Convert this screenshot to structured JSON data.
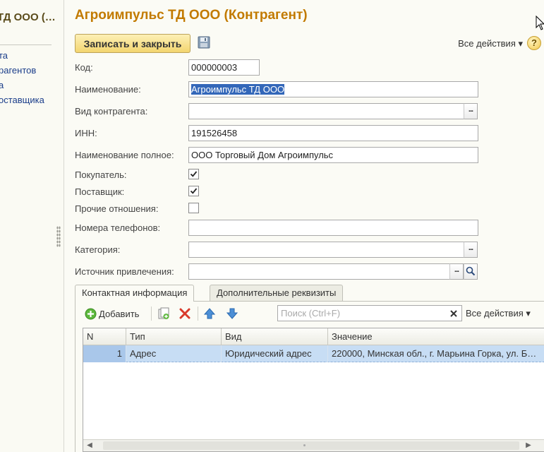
{
  "left_panel": {
    "title": "ТД ООО (…",
    "links": [
      "та",
      "рагентов",
      "а",
      "оставщика"
    ]
  },
  "form": {
    "title": "Агроимпульс ТД ООО (Контрагент)",
    "save_close_label": "Записать и закрыть",
    "all_actions_label": "Все действия ▾",
    "help_label": "?"
  },
  "fields": {
    "code_label": "Код:",
    "code_value": "000000003",
    "name_label": "Наименование:",
    "name_value": "Агроимпульс ТД ООО",
    "kind_label": "Вид контрагента:",
    "kind_value": "",
    "inn_label": "ИНН:",
    "inn_value": "191526458",
    "full_name_label": "Наименование полное:",
    "full_name_value": "ООО Торговый Дом Агроимпульс",
    "buyer_label": "Покупатель:",
    "buyer_checked": true,
    "supplier_label": "Поставщик:",
    "supplier_checked": true,
    "other_label": "Прочие отношения:",
    "other_checked": false,
    "phones_label": "Номера телефонов:",
    "phones_value": "",
    "category_label": "Категория:",
    "category_value": "",
    "source_label": "Источник привлечения:",
    "source_value": ""
  },
  "tabs": [
    {
      "label": "Контактная информация",
      "active": true
    },
    {
      "label": "Дополнительные реквизиты",
      "active": false
    }
  ],
  "contact_toolbar": {
    "add_label": "Добавить",
    "search_placeholder": "Поиск (Ctrl+F)",
    "all_actions_label": "Все действия ▾"
  },
  "contact_table": {
    "columns": [
      "N",
      "Тип",
      "Вид",
      "Значение"
    ],
    "rows": [
      {
        "n": "1",
        "type": "Адрес",
        "kind": "Юридический адрес",
        "value": "220000, Минская обл., г. Марьина Горка, ул. Б…"
      }
    ]
  },
  "colors": {
    "title": "#c27a00",
    "link": "#1a3d8a",
    "selection": "#3367b9",
    "row_selected": "#c7ddf4"
  }
}
